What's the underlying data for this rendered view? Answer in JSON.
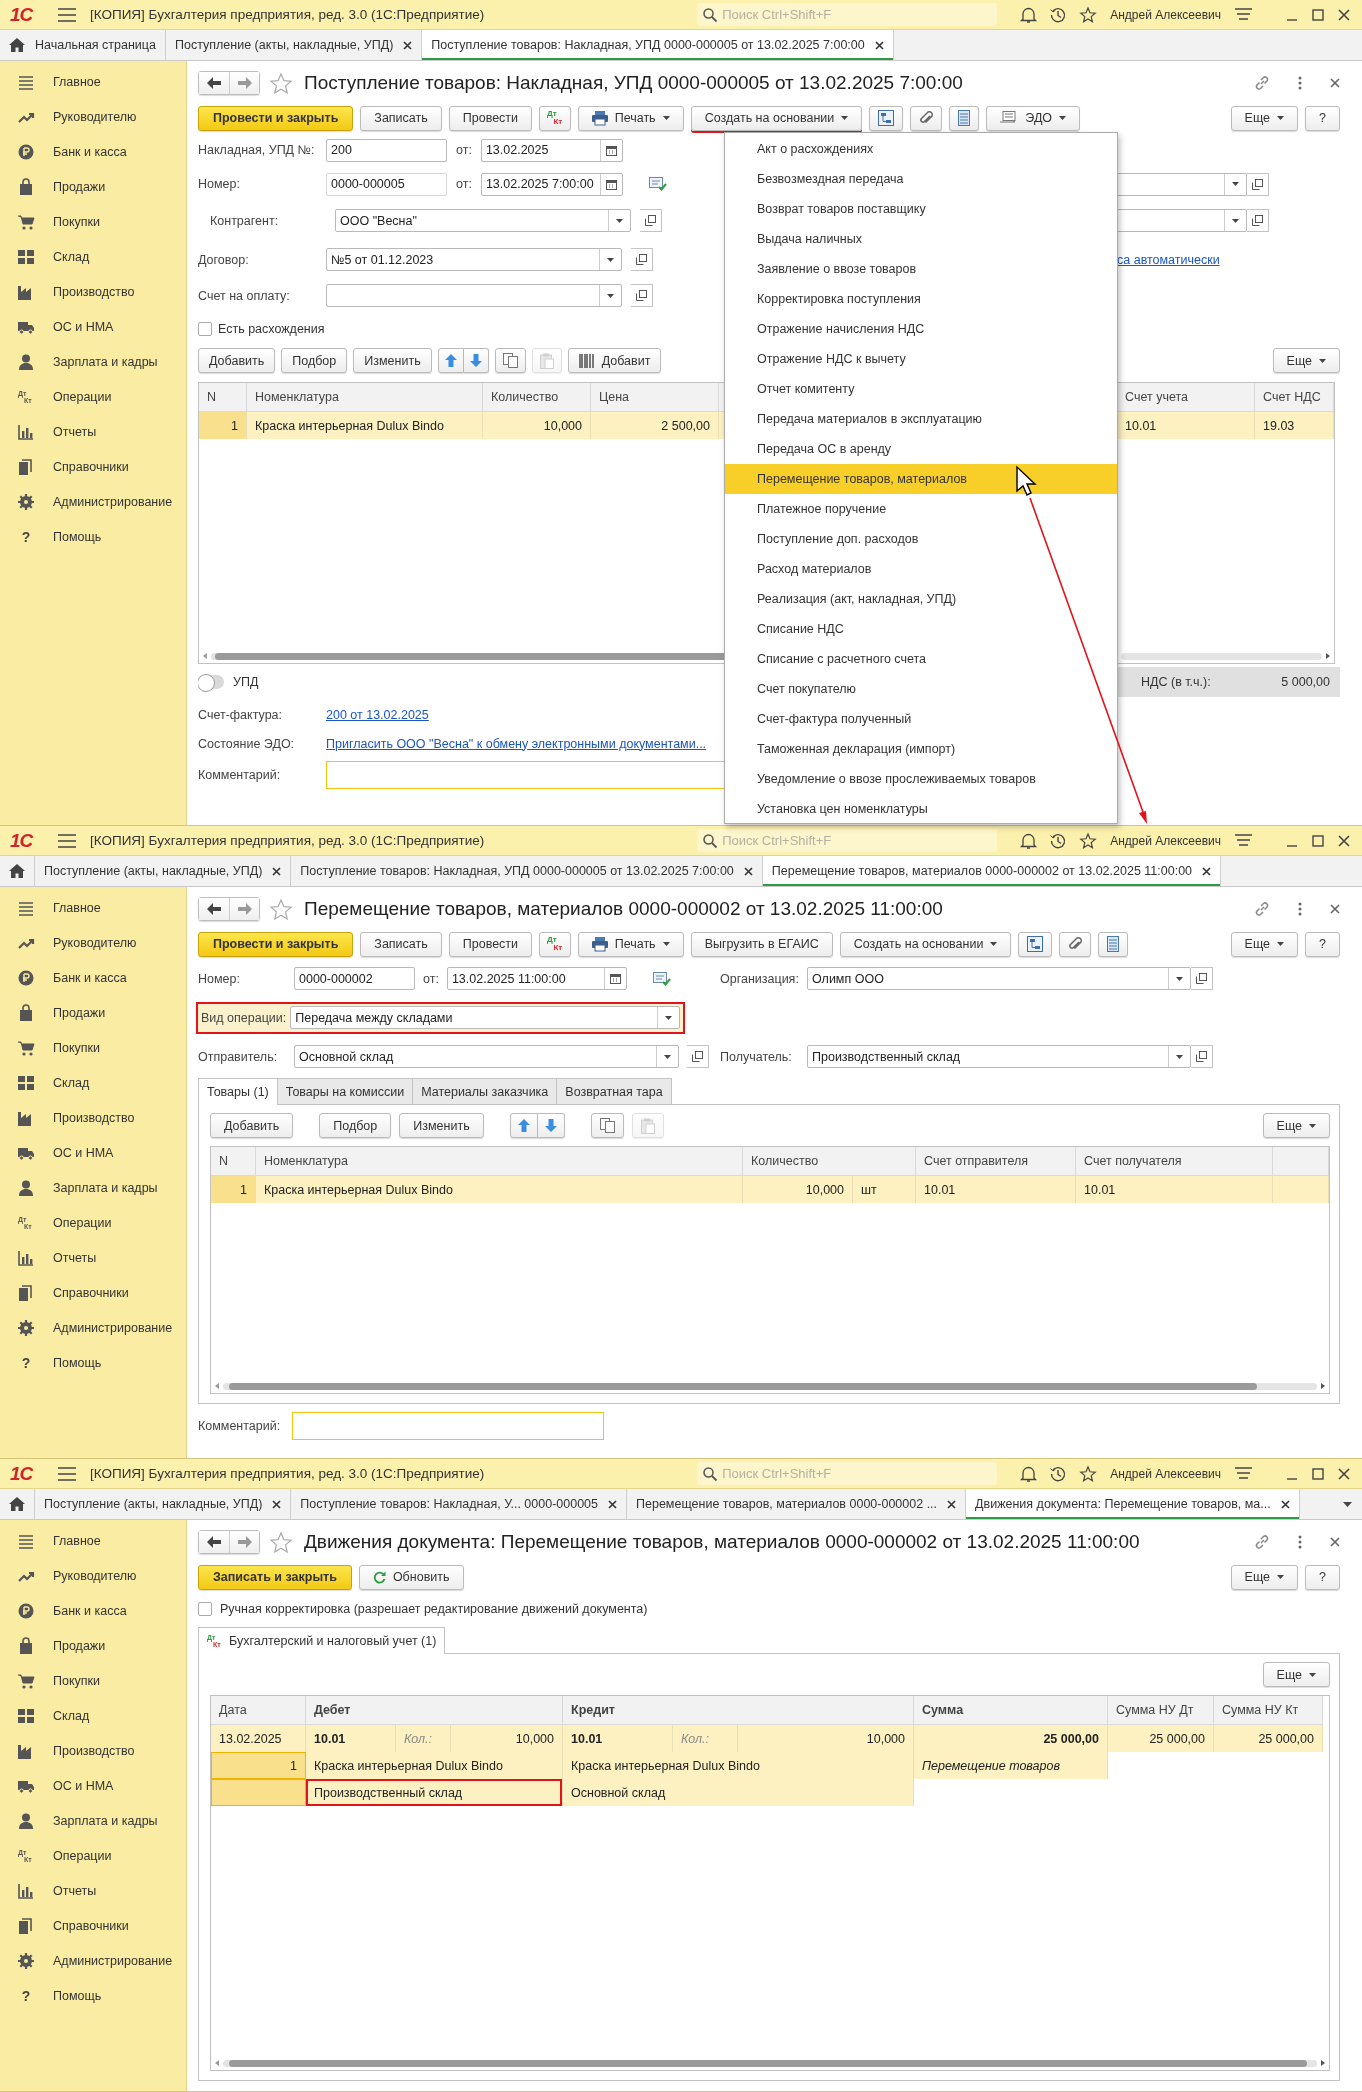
{
  "windows": [
    {
      "kind": "receipt",
      "logo": "1С",
      "app_title": "[КОПИЯ] Бухгалтерия предприятия, ред. 3.0 (1С:Предприятие)",
      "search": {
        "placeholder": "Поиск Ctrl+Shift+F"
      },
      "user": "Андрей Алексеевич",
      "tabs": [
        {
          "kind": "home",
          "label": "Начальная страница",
          "selected": false
        },
        {
          "kind": "doc",
          "label": "Поступление (акты, накладные, УПД)",
          "selected": false
        },
        {
          "kind": "doc",
          "label": "Поступление товаров: Накладная, УПД 0000-000005 от 13.02.2025 7:00:00",
          "selected": true
        }
      ],
      "sidebar": [
        {
          "label": "Главное"
        },
        {
          "label": "Руководителю"
        },
        {
          "label": "Банк и касса"
        },
        {
          "label": "Продажи"
        },
        {
          "label": "Покупки"
        },
        {
          "label": "Склад"
        },
        {
          "label": "Производство"
        },
        {
          "label": "ОС и НМА"
        },
        {
          "label": "Зарплата и кадры"
        },
        {
          "label": "Операции",
          "icon_letters": [
            "Дт",
            "Кт"
          ]
        },
        {
          "label": "Отчеты"
        },
        {
          "label": "Справочники"
        },
        {
          "label": "Администрирование"
        },
        {
          "label": "Помощь",
          "icon_char": "?"
        }
      ],
      "form": {
        "title": "Поступление товаров: Накладная, УПД 0000-000005 от 13.02.2025 7:00:00",
        "toolbar": [
          {
            "kind": "primary",
            "label": "Провести и закрыть"
          },
          {
            "kind": "plain",
            "label": "Записать"
          },
          {
            "kind": "plain",
            "label": "Провести"
          },
          {
            "kind": "dtkt",
            "letters": [
              "Дт",
              "Кт"
            ]
          },
          {
            "kind": "print",
            "label": "Печать"
          },
          {
            "kind": "menu",
            "label": "Создать на основании",
            "highlighted": true
          },
          {
            "kind": "structure"
          },
          {
            "kind": "attach"
          },
          {
            "kind": "list"
          },
          {
            "kind": "edo",
            "label": "ЭДО"
          }
        ],
        "toolbar_right": [
          {
            "kind": "menu",
            "label": "Еще"
          },
          {
            "kind": "plain",
            "label": "?"
          }
        ],
        "invoice": {
          "label": "Накладная, УПД №:",
          "value": "200",
          "date_label": "от:",
          "date": "13.02.2025"
        },
        "number": {
          "label": "Номер:",
          "value": "0000-000005",
          "date_label": "от:",
          "date": "13.02.2025 7:00:00"
        },
        "counterparty": {
          "label": "Контрагент:",
          "value": "ООО \"Весна\""
        },
        "contract": {
          "label": "Договор:",
          "value": "№5 от 01.12.2023",
          "link": "са автоматически"
        },
        "payment_invoice": {
          "label": "Счет на оплату:"
        },
        "discrepancy": {
          "label": "Есть расхождения",
          "checked": false
        },
        "table_buttons": [
          {
            "kind": "plain",
            "label": "Добавить"
          },
          {
            "kind": "plain",
            "label": "Подбор"
          },
          {
            "kind": "plain",
            "label": "Изменить"
          },
          {
            "kind": "updown"
          },
          {
            "kind": "copy"
          },
          {
            "kind": "paste",
            "disabled": true
          },
          {
            "kind": "barcode",
            "label": "Добавит"
          }
        ],
        "more_button": {
          "kind": "menu",
          "label": "Еще"
        },
        "table": {
          "columns": [
            "N",
            "Номенклатура",
            "Количество",
            "Цена"
          ],
          "right_columns": [
            "Счет учета",
            "Счет НДС"
          ],
          "rows": [
            {
              "selected": true,
              "cells": [
                "1",
                "Краска интерьерная Dulux Bindo",
                "10,000",
                "2 500,00"
              ],
              "right_cells": [
                "10.01",
                "19.03"
              ]
            }
          ]
        },
        "upd": {
          "label": "УПД",
          "on": false
        },
        "invoice_link": {
          "label": "Счет-фактура:",
          "link": "200 от 13.02.2025"
        },
        "edo": {
          "label": "Состояние ЭДО:",
          "link": "Пригласить ООО \"Весна\" к обмену электронными документами..."
        },
        "comment": {
          "label": "Комментарий:"
        },
        "vat": {
          "label": "НДС (в т.ч.):",
          "value": "5 000,00"
        },
        "menu": {
          "items": [
            {
              "label": "Акт о расхождениях",
              "selected": false
            },
            {
              "label": "Безвозмездная передача",
              "selected": false
            },
            {
              "label": "Возврат товаров поставщику",
              "selected": false
            },
            {
              "label": "Выдача наличных",
              "selected": false
            },
            {
              "label": "Заявление о ввозе товаров",
              "selected": false
            },
            {
              "label": "Корректировка поступления",
              "selected": false
            },
            {
              "label": "Отражение начисления НДС",
              "selected": false
            },
            {
              "label": "Отражение НДС к вычету",
              "selected": false
            },
            {
              "label": "Отчет комитенту",
              "selected": false
            },
            {
              "label": "Передача материалов в эксплуатацию",
              "selected": false
            },
            {
              "label": "Передача ОС в аренду",
              "selected": false
            },
            {
              "label": "Перемещение товаров, материалов",
              "selected": true
            },
            {
              "label": "Платежное поручение",
              "selected": false
            },
            {
              "label": "Поступление доп. расходов",
              "selected": false
            },
            {
              "label": "Расход материалов",
              "selected": false
            },
            {
              "label": "Реализация (акт, накладная, УПД)",
              "selected": false
            },
            {
              "label": "Списание НДС",
              "selected": false
            },
            {
              "label": "Списание с расчетного счета",
              "selected": false
            },
            {
              "label": "Счет покупателю",
              "selected": false
            },
            {
              "label": "Счет-фактура полученный",
              "selected": false
            },
            {
              "label": "Таможенная декларация (импорт)",
              "selected": false
            },
            {
              "label": "Уведомление о ввозе прослеживаемых товаров",
              "selected": false
            },
            {
              "label": "Установка цен номенклатуры",
              "selected": false
            }
          ]
        }
      }
    },
    {
      "kind": "transfer",
      "logo": "1С",
      "app_title": "[КОПИЯ] Бухгалтерия предприятия, ред. 3.0 (1С:Предприятие)",
      "search": {
        "placeholder": "Поиск Ctrl+Shift+F"
      },
      "user": "Андрей Алексеевич",
      "tabs": [
        {
          "kind": "home",
          "selected": false
        },
        {
          "kind": "doc",
          "label": "Поступление (акты, накладные, УПД)",
          "selected": false
        },
        {
          "kind": "doc",
          "label": "Поступление товаров: Накладная, УПД 0000-000005 от 13.02.2025 7:00:00",
          "selected": false
        },
        {
          "kind": "doc",
          "label": "Перемещение товаров, материалов 0000-000002 от 13.02.2025 11:00:00",
          "selected": true
        }
      ],
      "sidebar": [
        {
          "label": "Главное"
        },
        {
          "label": "Руководителю"
        },
        {
          "label": "Банк и касса"
        },
        {
          "label": "Продажи"
        },
        {
          "label": "Покупки"
        },
        {
          "label": "Склад"
        },
        {
          "label": "Производство"
        },
        {
          "label": "ОС и НМА"
        },
        {
          "label": "Зарплата и кадры"
        },
        {
          "label": "Операции",
          "icon_letters": [
            "Дт",
            "Кт"
          ]
        },
        {
          "label": "Отчеты"
        },
        {
          "label": "Справочники"
        },
        {
          "label": "Администрирование"
        },
        {
          "label": "Помощь",
          "icon_char": "?"
        }
      ],
      "form": {
        "title": "Перемещение товаров, материалов 0000-000002 от 13.02.2025 11:00:00",
        "toolbar": [
          {
            "kind": "primary",
            "label": "Провести и закрыть"
          },
          {
            "kind": "plain",
            "label": "Записать"
          },
          {
            "kind": "plain",
            "label": "Провести"
          },
          {
            "kind": "dtkt",
            "letters": [
              "Дт",
              "Кт"
            ]
          },
          {
            "kind": "print",
            "label": "Печать"
          },
          {
            "kind": "plain",
            "label": "Выгрузить в ЕГАИС"
          },
          {
            "kind": "menu",
            "label": "Создать на основании",
            "highlighted": false
          },
          {
            "kind": "structure"
          },
          {
            "kind": "attach"
          },
          {
            "kind": "list"
          }
        ],
        "toolbar_right": [
          {
            "kind": "menu",
            "label": "Еще"
          },
          {
            "kind": "plain",
            "label": "?"
          }
        ],
        "number": {
          "label": "Номер:",
          "value": "0000-000002",
          "date_label": "от:",
          "date": "13.02.2025 11:00:00"
        },
        "organization": {
          "label": "Организация:",
          "value": "Олимп ООО"
        },
        "operation": {
          "label": "Вид операции:",
          "value": "Передача между складами",
          "highlighted": true
        },
        "sender": {
          "label": "Отправитель:",
          "value": "Основной склад"
        },
        "receiver": {
          "label": "Получатель:",
          "value": "Производственный склад"
        },
        "tabs": [
          {
            "label": "Товары (1)",
            "selected": true
          },
          {
            "label": "Товары на комиссии",
            "selected": false
          },
          {
            "label": "Материалы заказчика",
            "selected": false
          },
          {
            "label": "Возвратная тара",
            "selected": false
          }
        ],
        "table_buttons": [
          {
            "kind": "plain",
            "label": "Добавить"
          },
          {
            "kind": "plain",
            "label": "Подбор"
          },
          {
            "kind": "plain",
            "label": "Изменить"
          },
          {
            "kind": "updown"
          },
          {
            "kind": "copy"
          },
          {
            "kind": "paste",
            "disabled": true
          }
        ],
        "more_button": {
          "kind": "menu",
          "label": "Еще"
        },
        "table": {
          "columns": [
            "N",
            "Номенклатура",
            "Количество",
            "",
            "Счет отправителя",
            "Счет получателя"
          ],
          "rows": [
            {
              "selected": true,
              "cells": [
                "1",
                "Краска интерьерная Dulux Bindo",
                "10,000",
                "шт",
                "10.01",
                "10.01"
              ]
            }
          ]
        },
        "comment": {
          "label": "Комментарий:"
        }
      }
    },
    {
      "kind": "postings",
      "logo": "1С",
      "app_title": "[КОПИЯ] Бухгалтерия предприятия, ред. 3.0 (1С:Предприятие)",
      "search": {
        "placeholder": "Поиск Ctrl+Shift+F"
      },
      "user": "Андрей Алексеевич",
      "tabs_overflow": true,
      "tabs": [
        {
          "kind": "home",
          "selected": false
        },
        {
          "kind": "doc",
          "label": "Поступление (акты, накладные, УПД)",
          "selected": false
        },
        {
          "kind": "doc",
          "label": "Поступление товаров: Накладная, У... 0000-000005",
          "selected": false
        },
        {
          "kind": "doc",
          "label": "Перемещение товаров, материалов 0000-000002 ...",
          "selected": false
        },
        {
          "kind": "doc",
          "label": "Движения документа: Перемещение товаров, ма...",
          "selected": true
        }
      ],
      "sidebar": [
        {
          "label": "Главное"
        },
        {
          "label": "Руководителю"
        },
        {
          "label": "Банк и касса"
        },
        {
          "label": "Продажи"
        },
        {
          "label": "Покупки"
        },
        {
          "label": "Склад"
        },
        {
          "label": "Производство"
        },
        {
          "label": "ОС и НМА"
        },
        {
          "label": "Зарплата и кадры"
        },
        {
          "label": "Операции",
          "icon_letters": [
            "Дт",
            "Кт"
          ]
        },
        {
          "label": "Отчеты"
        },
        {
          "label": "Справочники"
        },
        {
          "label": "Администрирование"
        },
        {
          "label": "Помощь",
          "icon_char": "?"
        }
      ],
      "form": {
        "title": "Движения документа: Перемещение товаров, материалов 0000-000002 от 13.02.2025 11:00:00",
        "toolbar": [
          {
            "kind": "primary",
            "label": "Записать и закрыть"
          },
          {
            "kind": "refresh",
            "label": "Обновить"
          }
        ],
        "toolbar_right": [
          {
            "kind": "menu",
            "label": "Еще"
          },
          {
            "kind": "plain",
            "label": "?"
          }
        ],
        "manual": {
          "label": "Ручная корректировка (разрешает редактирование движений документа)",
          "checked": false
        },
        "tab": {
          "label": "Бухгалтерский и налоговый учет (1)",
          "letters": [
            "Дт",
            "Кт"
          ],
          "selected": true
        },
        "more_button": {
          "kind": "menu",
          "label": "Еще"
        },
        "table": {
          "columns": [
            {
              "label": "Дата",
              "bold": false
            },
            {
              "label": "Дебет",
              "bold": true
            },
            {
              "label": "Кредит",
              "bold": true
            },
            {
              "label": "Сумма",
              "bold": true
            },
            {
              "label": "Сумма НУ Дт",
              "bold": false
            },
            {
              "label": "Сумма НУ Кт",
              "bold": false
            }
          ],
          "rows": [
            {
              "selected": true,
              "date": "13.02.2025",
              "line_number": "1",
              "debit": {
                "account": "10.01",
                "qty_label": "Кол.:",
                "qty": "10,000",
                "item": "Краска интерьерная Dulux Bindo",
                "warehouse": "Производственный склад",
                "highlighted": true
              },
              "credit": {
                "account": "10.01",
                "qty_label": "Кол.:",
                "qty": "10,000",
                "item": "Краска интерьерная Dulux Bindo",
                "warehouse": "Основной склад",
                "highlighted": false
              },
              "sum": "25 000,00",
              "content": "Перемещение товаров",
              "sum_tax_dt": "25 000,00",
              "sum_tax_kt": "25 000,00"
            }
          ]
        }
      }
    }
  ]
}
